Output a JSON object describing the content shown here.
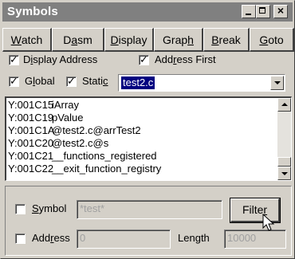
{
  "window": {
    "title": "Symbols"
  },
  "tabs": [
    {
      "pre": "",
      "acc": "W",
      "post": "atch"
    },
    {
      "pre": "D",
      "acc": "a",
      "post": "sm"
    },
    {
      "pre": "",
      "acc": "D",
      "post": "isplay"
    },
    {
      "pre": "Grap",
      "acc": "h",
      "post": ""
    },
    {
      "pre": "",
      "acc": "B",
      "post": "reak"
    },
    {
      "pre": "",
      "acc": "G",
      "post": "oto"
    }
  ],
  "options": {
    "display_address": {
      "pre": "D",
      "acc": "i",
      "post": "splay Address",
      "checked": true
    },
    "address_first": {
      "pre": "Add",
      "acc": "r",
      "post": "ess First",
      "checked": true
    },
    "global": {
      "pre": "G",
      "acc": "l",
      "post": "obal",
      "checked": true
    },
    "static": {
      "pre": "Stati",
      "acc": "c",
      "post": "",
      "checked": true
    },
    "file_value": "test2.c"
  },
  "symbols": [
    {
      "address": "Y:001C15",
      "name": "iArray"
    },
    {
      "address": "Y:001C19",
      "name": "pValue"
    },
    {
      "address": "Y:001C1A",
      "name": "@test2.c@arrTest2"
    },
    {
      "address": "Y:001C20",
      "name": "@test2.c@s"
    },
    {
      "address": "Y:001C21",
      "name": "__functions_registered"
    },
    {
      "address": "Y:001C22",
      "name": "__exit_function_registry"
    }
  ],
  "filter": {
    "symbol_label": {
      "pre": "",
      "acc": "S",
      "post": "ymbol"
    },
    "symbol_value": "*test*",
    "symbol_checked": false,
    "filter_button": {
      "pre": "Filte",
      "acc": "r",
      "post": ""
    },
    "address_label": {
      "pre": "Add",
      "acc": "r",
      "post": "ess"
    },
    "address_value": "0",
    "address_checked": false,
    "length_label": {
      "pre": "Len",
      "acc": "g",
      "post": "th"
    },
    "length_value": "10000"
  }
}
